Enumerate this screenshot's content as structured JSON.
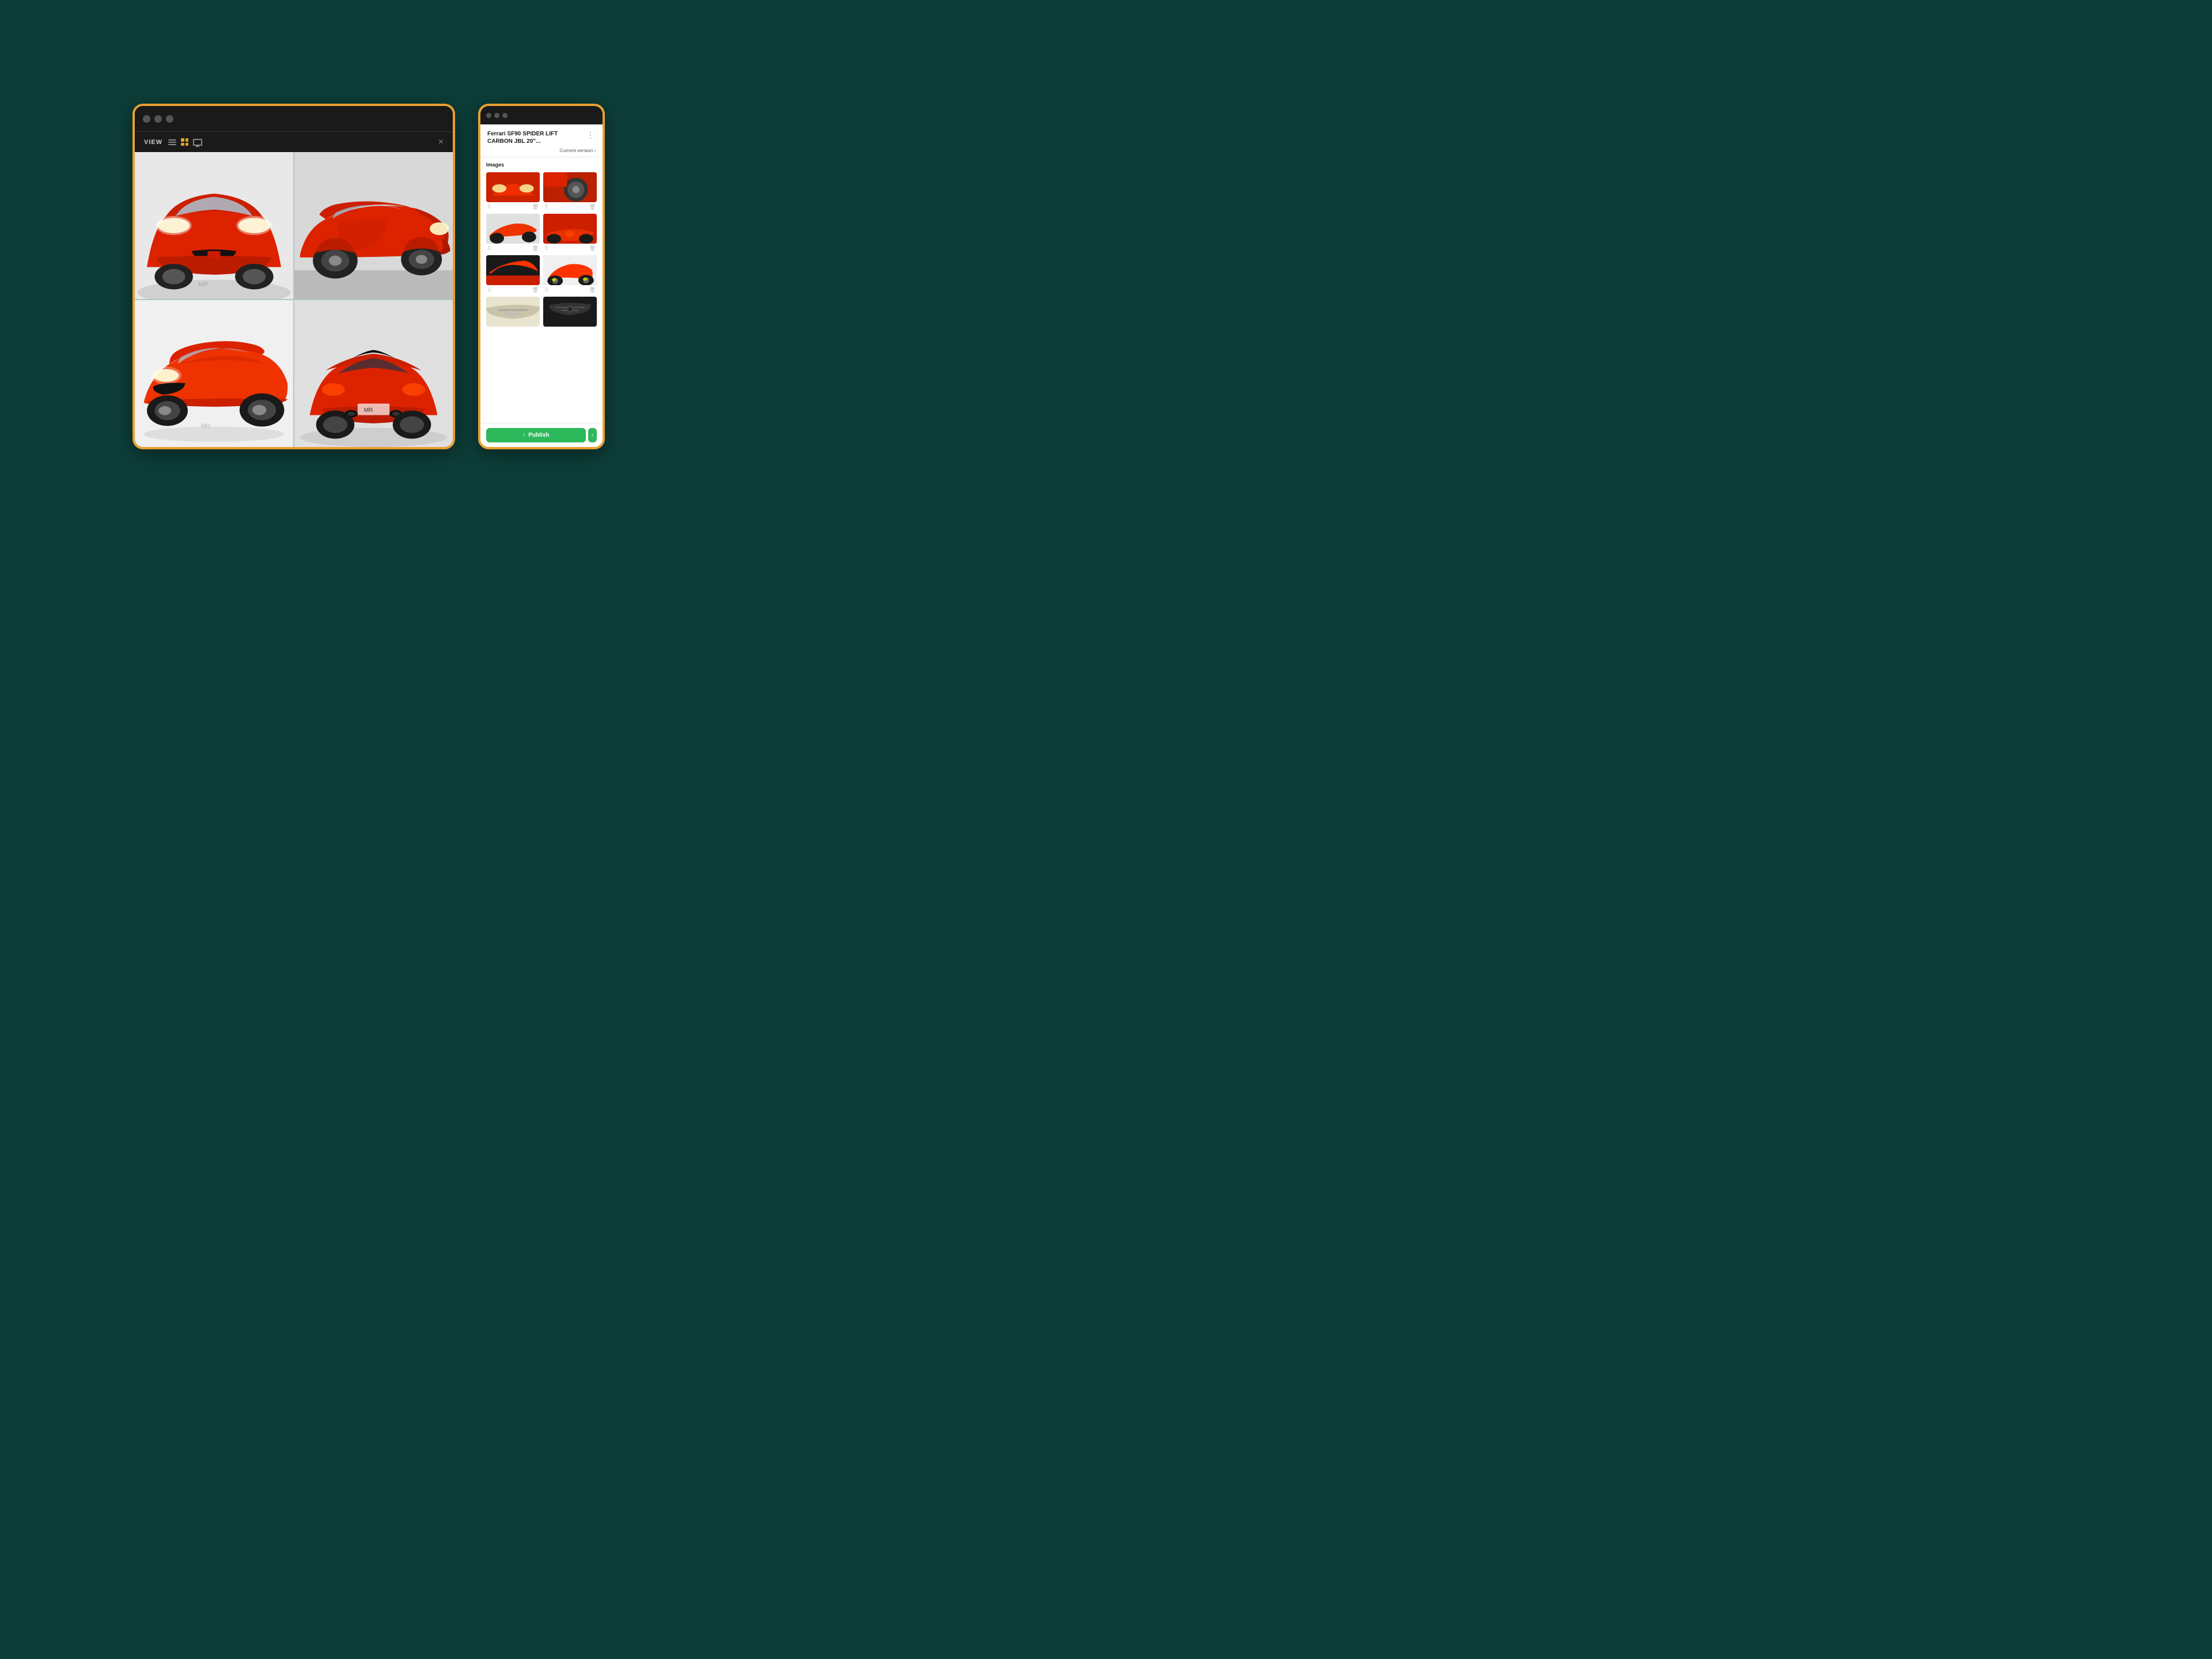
{
  "background_color": "#0d3d38",
  "left_window": {
    "border_color": "#e8a030",
    "toolbar": {
      "view_label": "VIEW",
      "close_label": "×"
    },
    "images": [
      {
        "id": 1,
        "alt": "Ferrari SF90 front view",
        "class": "ferrari-front"
      },
      {
        "id": 2,
        "alt": "Ferrari SF90 side view",
        "class": "ferrari-side1"
      },
      {
        "id": 3,
        "alt": "Ferrari SF90 three-quarter view",
        "class": "ferrari-side2"
      },
      {
        "id": 4,
        "alt": "Ferrari SF90 rear view",
        "class": "ferrari-rear"
      }
    ]
  },
  "right_window": {
    "border_color": "#e8a030",
    "header": {
      "title": "Ferrari SF90 SPIDER LIFT CARBON JBL 20\"...",
      "version_label": "Current version",
      "more_icon": "⋮"
    },
    "images_section": {
      "title": "Images",
      "thumbnails": [
        {
          "id": 1,
          "class": "thumb-ferrari-1",
          "alt": "Ferrari front"
        },
        {
          "id": 2,
          "class": "thumb-ferrari-2",
          "alt": "Ferrari wheel"
        },
        {
          "id": 3,
          "class": "thumb-ferrari-3",
          "alt": "Ferrari side"
        },
        {
          "id": 4,
          "class": "thumb-ferrari-4",
          "alt": "Ferrari rear side"
        },
        {
          "id": 5,
          "class": "thumb-ferrari-5",
          "alt": "Ferrari back"
        },
        {
          "id": 6,
          "class": "thumb-ferrari-6",
          "alt": "Ferrari profile"
        },
        {
          "id": 7,
          "class": "thumb-ferrari-7",
          "alt": "Ferrari interior"
        },
        {
          "id": 8,
          "class": "thumb-ferrari-8",
          "alt": "Ferrari engine"
        }
      ]
    },
    "footer": {
      "publish_label": "Publish",
      "publish_up_icon": "↑"
    }
  },
  "icons": {
    "drag": "⠿",
    "trash": "🗑",
    "chevron_down": "›"
  }
}
